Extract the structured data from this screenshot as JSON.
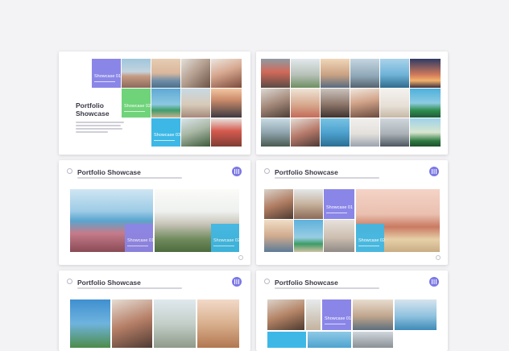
{
  "colors": {
    "purple": "#8a86e8",
    "green": "#6fd37a",
    "blue": "#3db8e6",
    "background": "#f3f3f5"
  },
  "title_slide": {
    "title": "Portfolio",
    "title_line2": "Showcase",
    "tiles": [
      "Showcase 01",
      "Showcase 02",
      "Showcase 03"
    ]
  },
  "slide3": {
    "title": "Portfolio Showcase",
    "tiles": [
      "Showcase 01",
      "Showcase 02"
    ]
  },
  "slide4": {
    "title": "Portfolio Showcase",
    "tiles": [
      "Showcase 01",
      "Showcase 02"
    ]
  },
  "slide5": {
    "title": "Portfolio Showcase"
  },
  "slide6": {
    "title": "Portfolio Showcase",
    "tiles": [
      "Showcase 01"
    ]
  }
}
